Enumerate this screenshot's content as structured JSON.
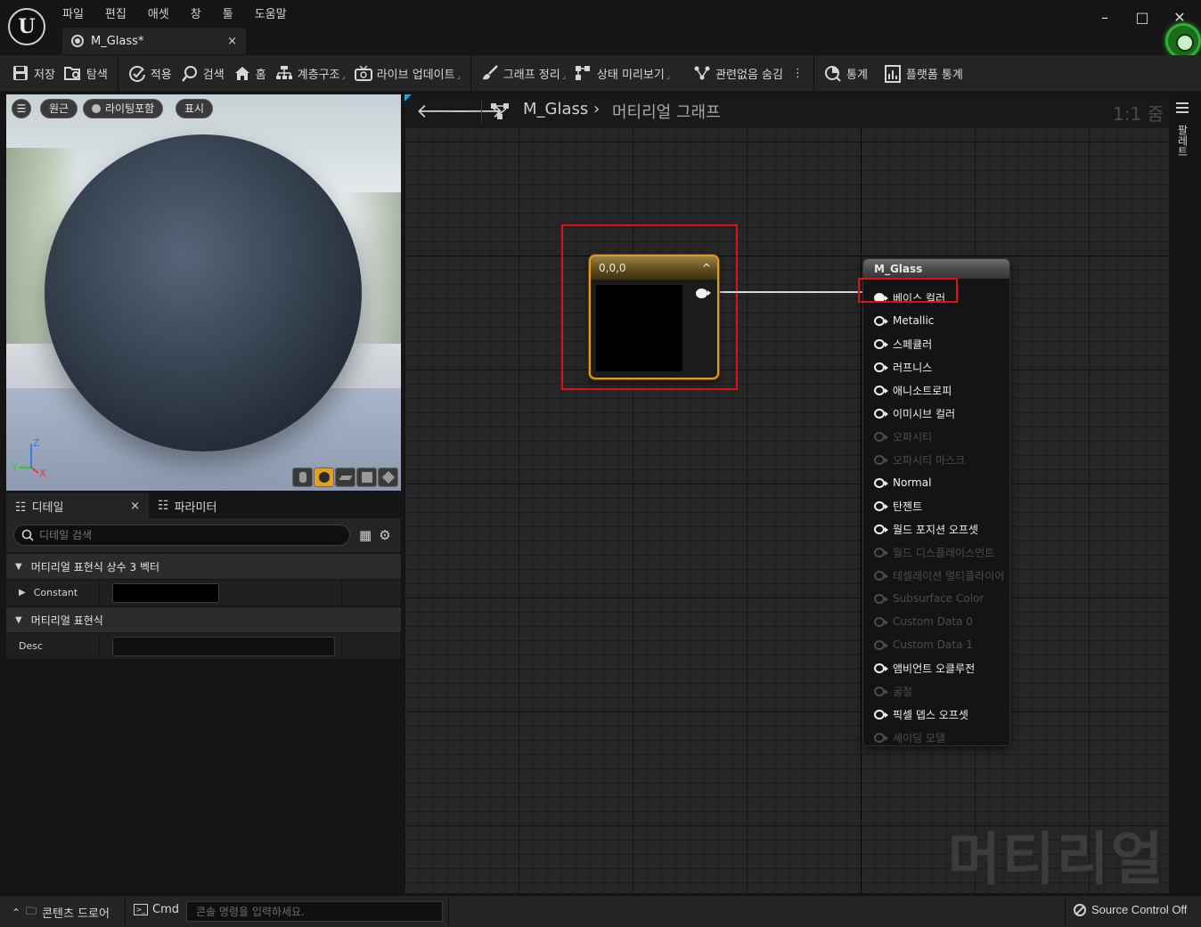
{
  "app": {
    "logo": "ue-logo",
    "logo_glyph": "U",
    "menu": [
      "파일",
      "편집",
      "애셋",
      "창",
      "툴",
      "도움말"
    ],
    "document_tab": {
      "label": "M_Glass*",
      "close": "×"
    },
    "window_controls": {
      "minimize": "–",
      "maximize": "□",
      "close": "✕"
    },
    "status_indicator_color": "#32b032"
  },
  "toolbar": {
    "save": "저장",
    "browse": "탐색",
    "apply": "적용",
    "search": "검색",
    "home": "홈",
    "hierarchy": "계층구조",
    "live_update": "라이브 업데이트",
    "clean_graph": "그래프 정리",
    "preview_state": "상태 미리보기",
    "hide_unrelated": "관련없음 숨김",
    "stats": "통계",
    "platform_stats": "플랫폼 통계",
    "more": "⋮"
  },
  "viewport": {
    "menu_icon": "☰",
    "perspective": "원근",
    "lit": "라이팅포함",
    "show": "표시",
    "axes": {
      "x": "X",
      "y": "Y",
      "z": "Z"
    },
    "preview_shapes": [
      "cylinder",
      "sphere",
      "plane",
      "cube",
      "custom"
    ],
    "active_shape": "sphere"
  },
  "details": {
    "tab_details": "디테일",
    "tab_close": "×",
    "tab_parameters": "파라미터",
    "search_placeholder": "디테일 검색",
    "section1": "머티리얼 표현식 상수 3 벡터",
    "constant_label": "Constant",
    "constant_color": "#000000",
    "section2": "머티리얼 표현식",
    "desc_label": "Desc",
    "desc_value": ""
  },
  "graph": {
    "breadcrumb_asset": "M_Glass",
    "breadcrumb_sep": "›",
    "breadcrumb_graph": "머티리얼 그래프",
    "zoom": "1:1 줌",
    "watermark": "머티리얼",
    "constant_node": {
      "title": "0,0,0",
      "collapse": "^",
      "preview_color": "#000000"
    },
    "result_node": {
      "title": "M_Glass",
      "pins": [
        {
          "label": "베이스 컬러",
          "enabled": true,
          "connected": true
        },
        {
          "label": "Metallic",
          "enabled": true,
          "connected": false
        },
        {
          "label": "스페큘러",
          "enabled": true,
          "connected": false
        },
        {
          "label": "러프니스",
          "enabled": true,
          "connected": false
        },
        {
          "label": "애니소트로피",
          "enabled": true,
          "connected": false
        },
        {
          "label": "이미시브 컬러",
          "enabled": true,
          "connected": false
        },
        {
          "label": "오파시티",
          "enabled": false,
          "connected": false
        },
        {
          "label": "오파시티 마스크",
          "enabled": false,
          "connected": false
        },
        {
          "label": "Normal",
          "enabled": true,
          "connected": false
        },
        {
          "label": "탄젠트",
          "enabled": true,
          "connected": false
        },
        {
          "label": "월드 포지션 오프셋",
          "enabled": true,
          "connected": false
        },
        {
          "label": "월드 디스플레이스먼트",
          "enabled": false,
          "connected": false
        },
        {
          "label": "테셀레이션 멀티플라이어",
          "enabled": false,
          "connected": false
        },
        {
          "label": "Subsurface Color",
          "enabled": false,
          "connected": false
        },
        {
          "label": "Custom Data 0",
          "enabled": false,
          "connected": false
        },
        {
          "label": "Custom Data 1",
          "enabled": false,
          "connected": false
        },
        {
          "label": "앰비언트 오클루전",
          "enabled": true,
          "connected": false
        },
        {
          "label": "굴절",
          "enabled": false,
          "connected": false
        },
        {
          "label": "픽셀 뎁스 오프셋",
          "enabled": true,
          "connected": false
        },
        {
          "label": "셰이딩 모델",
          "enabled": false,
          "connected": false
        }
      ]
    },
    "highlight_color": "#e01010"
  },
  "palette": {
    "label": "팔레트"
  },
  "statusbar": {
    "content_drawer": "콘텐츠 드로어",
    "cmd": "Cmd",
    "console_placeholder": "콘솔 명령을 입력하세요.",
    "source_control": "Source Control Off"
  }
}
